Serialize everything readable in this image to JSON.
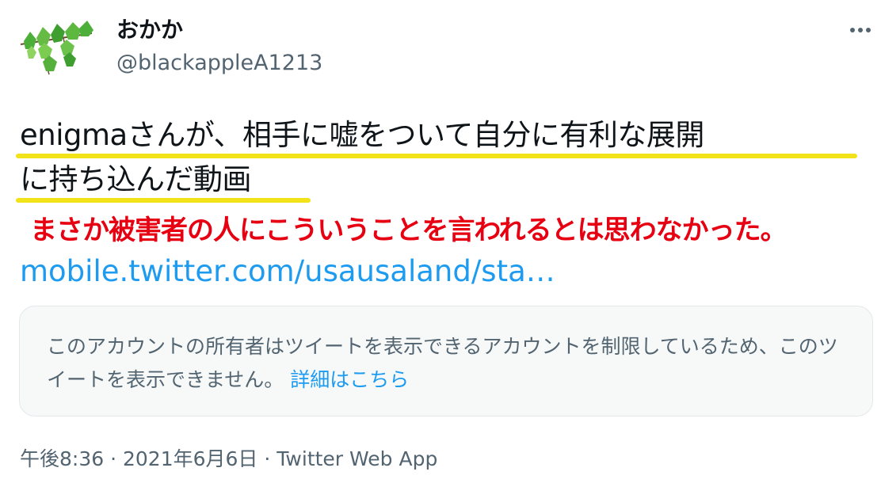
{
  "author": {
    "display_name": "おかか",
    "handle": "@blackappleA1213"
  },
  "tweet": {
    "line1": "enigmaさんが、相手に嘘をついて自分に有利な展開",
    "line2": "に持ち込んだ動画",
    "link": "mobile.twitter.com/usausaland/sta…"
  },
  "annotation": "まさか被害者の人にこういうことを言われるとは思わなかった。",
  "quoted_notice": {
    "text": "このアカウントの所有者はツイートを表示できるアカウントを制限しているため、このツイートを表示できません。",
    "link_label": "詳細はこちら"
  },
  "meta": {
    "time": "午後8:36",
    "separator": "·",
    "date": "2021年6月6日",
    "client": "Twitter Web App"
  },
  "icons": {
    "more": "more-options-icon",
    "avatar": "ivy-leaves-avatar"
  },
  "colors": {
    "link": "#1d9bf0",
    "annotation": "#e60012",
    "highlight": "#f2e21a",
    "secondary_text": "#536471"
  }
}
